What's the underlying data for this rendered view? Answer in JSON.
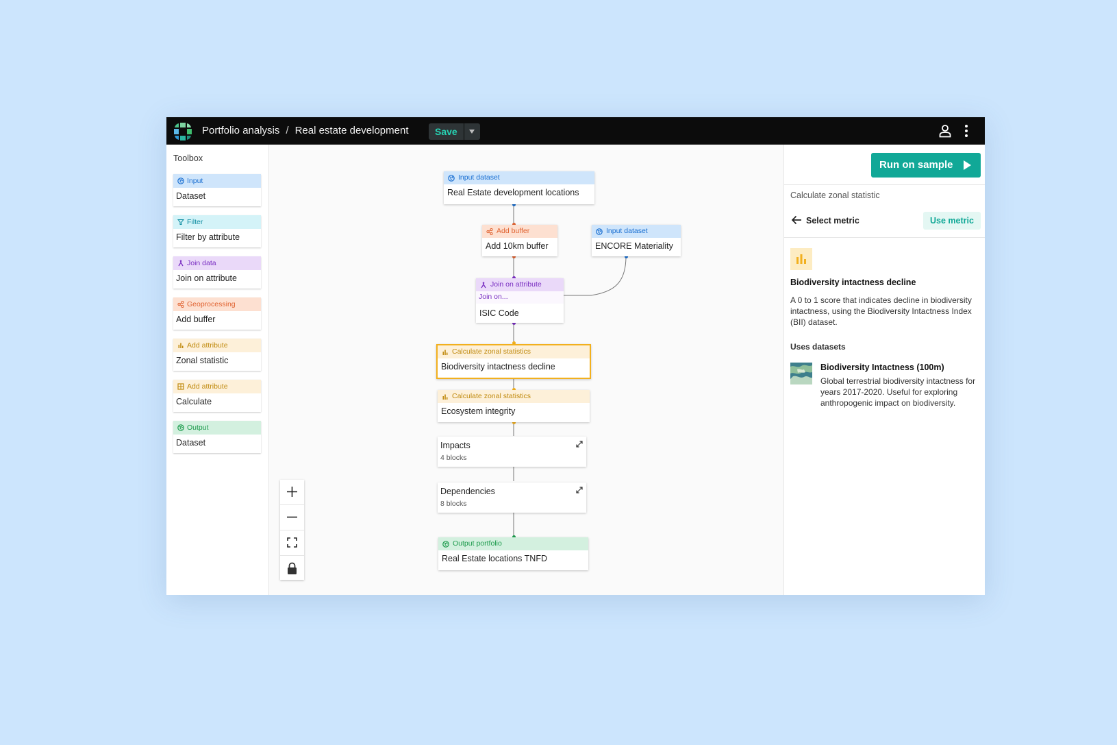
{
  "topbar": {
    "crumb_parent": "Portfolio analysis",
    "crumb_sep": "/",
    "crumb_current": "Real estate development",
    "save_label": "Save"
  },
  "toolbox": {
    "title": "Toolbox",
    "items": [
      {
        "category": "Input",
        "name": "Dataset",
        "icon": "globe-icon"
      },
      {
        "category": "Filter",
        "name": "Filter by attribute",
        "icon": "filter-icon"
      },
      {
        "category": "Join data",
        "name": "Join on attribute",
        "icon": "join-icon"
      },
      {
        "category": "Geoprocessing",
        "name": "Add buffer",
        "icon": "buffer-icon"
      },
      {
        "category": "Add attribute",
        "name": "Zonal statistic",
        "icon": "bar-chart-icon"
      },
      {
        "category": "Add attribute",
        "name": "Calculate",
        "icon": "calculator-icon"
      },
      {
        "category": "Output",
        "name": "Dataset",
        "icon": "globe-icon"
      }
    ]
  },
  "canvas": {
    "nodes": {
      "input1": {
        "type": "Input dataset",
        "name": "Real Estate development locations"
      },
      "buffer": {
        "type": "Add buffer",
        "name": "Add 10km buffer"
      },
      "input2": {
        "type": "Input dataset",
        "name": "ENCORE Materiality"
      },
      "join": {
        "type": "Join on attribute",
        "sub": "Join on...",
        "name": "ISIC Code"
      },
      "zonal1": {
        "type": "Calculate zonal statistics",
        "name": "Biodiversity intactness decline"
      },
      "zonal2": {
        "type": "Calculate zonal statistics",
        "name": "Ecosystem integrity"
      },
      "output": {
        "type": "Output portfolio",
        "name": "Real Estate locations TNFD"
      }
    },
    "groups": {
      "impacts": {
        "title": "Impacts",
        "count": "4 blocks"
      },
      "dependencies": {
        "title": "Dependencies",
        "count": "8 blocks"
      }
    }
  },
  "panel": {
    "run_label": "Run on sample",
    "subtitle": "Calculate zonal statistic",
    "back_label": "Select metric",
    "use_metric_label": "Use metric",
    "metric": {
      "title": "Biodiversity intactness decline",
      "description": "A 0 to 1 score that indicates decline in biodiversity intactness, using the Biodiversity Intactness Index (BII) dataset."
    },
    "uses_datasets_title": "Uses datasets",
    "dataset": {
      "name": "Biodiversity Intactness (100m)",
      "description": "Global terrestrial biodiversity intactness for years 2017-2020. Useful for exploring anthropogenic impact on biodiversity."
    }
  },
  "colors": {
    "input": "#cfe5fb",
    "input_text": "#1a6fd1",
    "filter": "#d4f3f8",
    "filter_text": "#138fa3",
    "join": "#ead9f9",
    "join_text": "#7a2fc2",
    "geo": "#fde0d1",
    "geo_text": "#e06230",
    "attr": "#fdf0d9",
    "attr_text": "#c08a0e",
    "output": "#d3f0df",
    "output_text": "#1b9a4b",
    "accent": "#11a897",
    "selected": "#f2b01e"
  }
}
